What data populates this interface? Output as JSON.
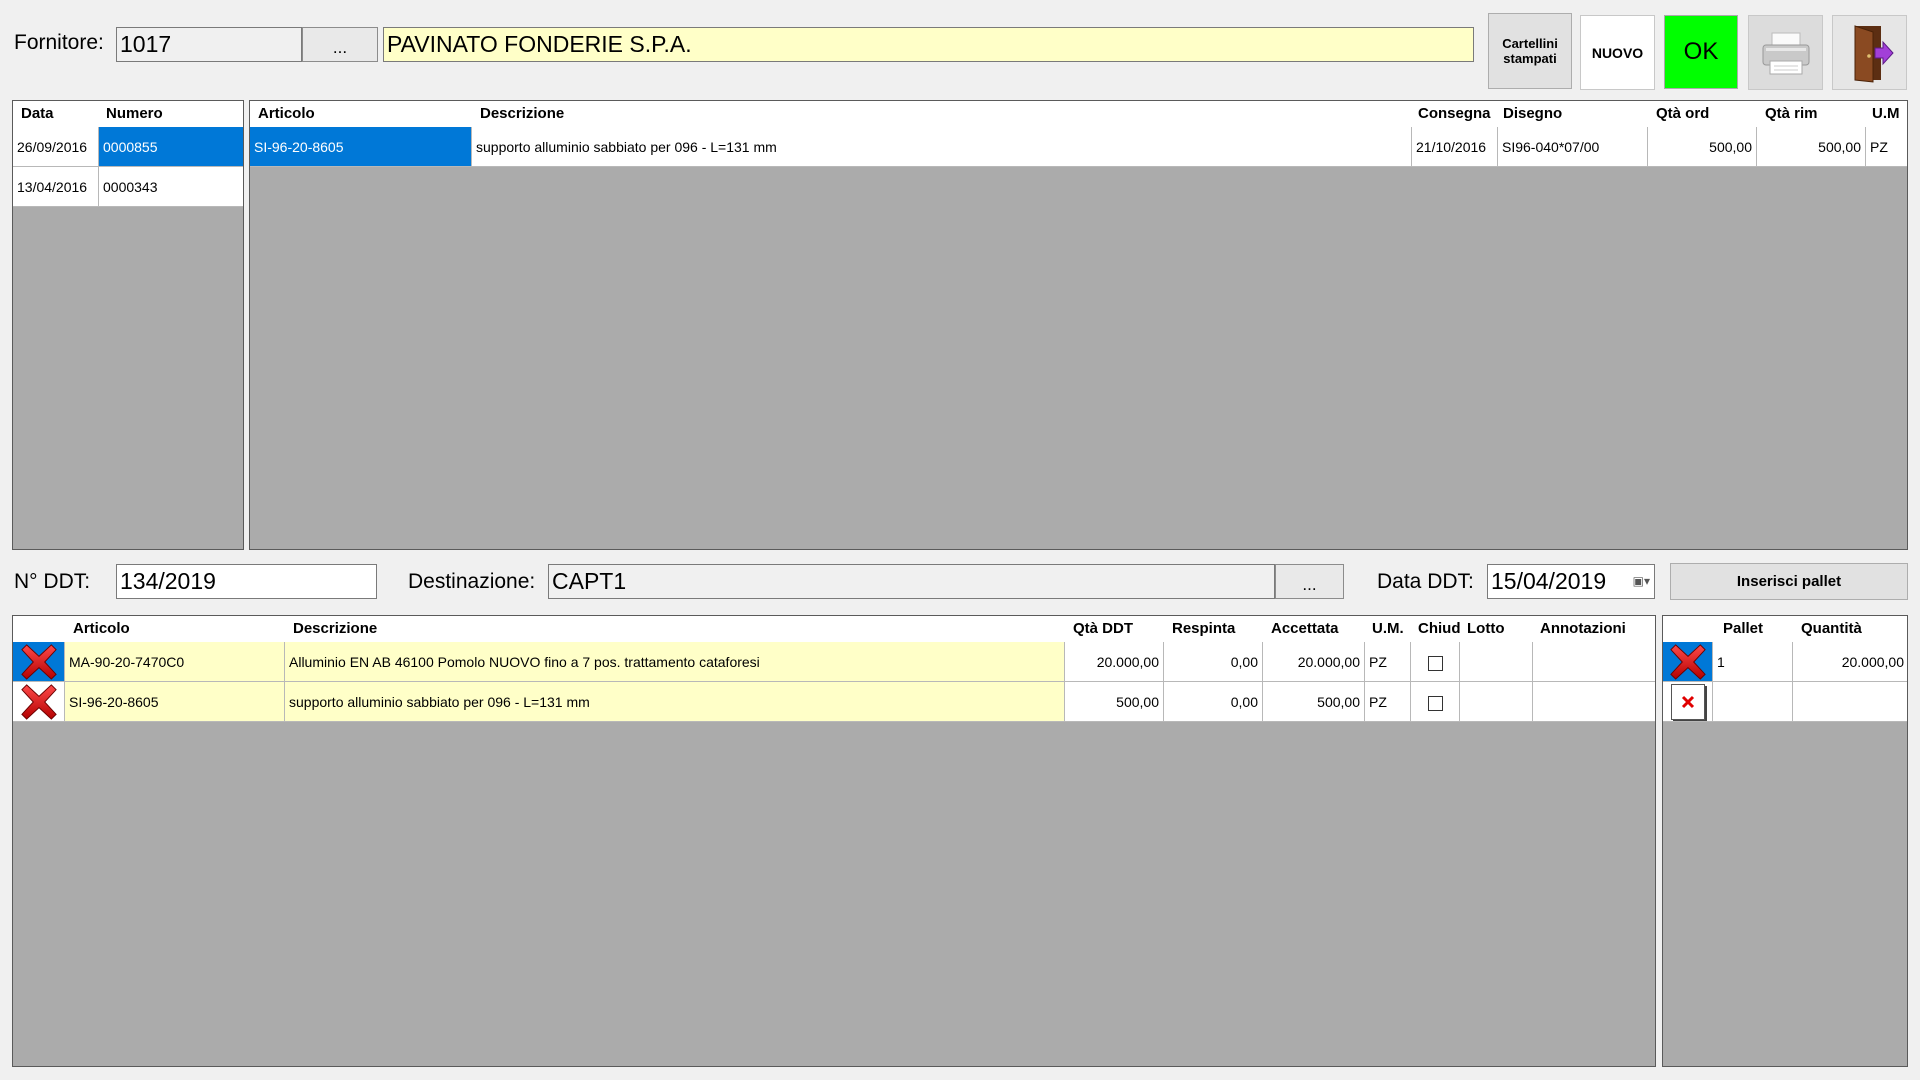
{
  "header": {
    "fornitore_label": "Fornitore:",
    "fornitore_code": "1017",
    "lookup_label": "...",
    "fornitore_name": "PAVINATO FONDERIE  S.P.A.",
    "cartellini_label": "Cartellini stampati",
    "nuovo_label": "NUOVO",
    "ok_label": "OK",
    "print_icon": "printer-icon",
    "exit_icon": "exit-door-icon"
  },
  "orders": {
    "columns": [
      "Data",
      "Numero"
    ],
    "rows": [
      {
        "data": "26/09/2016",
        "numero": "0000855",
        "selected": true
      },
      {
        "data": "13/04/2016",
        "numero": "0000343",
        "selected": false
      }
    ]
  },
  "order_lines": {
    "columns": [
      "Articolo",
      "Descrizione",
      "Consegna",
      "Disegno",
      "Qtà ord",
      "Qtà rim",
      "U.M"
    ],
    "rows": [
      {
        "articolo": "SI-96-20-8605",
        "descrizione": "supporto alluminio sabbiato per 096 - L=131 mm",
        "consegna": "21/10/2016",
        "disegno": "SI96-040*07/00",
        "qta_ord": "500,00",
        "qta_rim": "500,00",
        "um": "PZ"
      }
    ]
  },
  "ddt": {
    "num_label": "N° DDT:",
    "num_value": "134/2019",
    "dest_label": "Destinazione:",
    "dest_value": "CAPT1",
    "lookup_label": "...",
    "date_label": "Data DDT:",
    "date_value": "15/04/2019",
    "pallet_button": "Inserisci pallet"
  },
  "ddt_lines": {
    "columns": [
      "Articolo",
      "Descrizione",
      "Qtà DDT",
      "Respinta",
      "Accettata",
      "U.M.",
      "Chiud",
      "Lotto",
      "Annotazioni"
    ],
    "rows": [
      {
        "articolo": "MA-90-20-7470C0",
        "descrizione": "Alluminio EN AB 46100 Pomolo NUOVO fino a 7 pos. trattamento cataforesi",
        "qta_ddt": "20.000,00",
        "respinta": "0,00",
        "accettata": "20.000,00",
        "um": "PZ",
        "chiuso": false,
        "lotto": "",
        "annotazioni": ""
      },
      {
        "articolo": "SI-96-20-8605",
        "descrizione": "supporto alluminio sabbiato per 096 - L=131 mm",
        "qta_ddt": "500,00",
        "respinta": "0,00",
        "accettata": "500,00",
        "um": "PZ",
        "chiuso": false,
        "lotto": "",
        "annotazioni": ""
      }
    ]
  },
  "pallets": {
    "columns": [
      "Pallet",
      "Quantità"
    ],
    "rows": [
      {
        "pallet": "1",
        "quantita": "20.000,00"
      },
      {
        "pallet": "",
        "quantita": ""
      }
    ]
  },
  "colors": {
    "selection": "#0078d7",
    "ok_green": "#00ff00",
    "highlight_yellow": "#ffffc8",
    "grid_gray": "#ababab"
  }
}
